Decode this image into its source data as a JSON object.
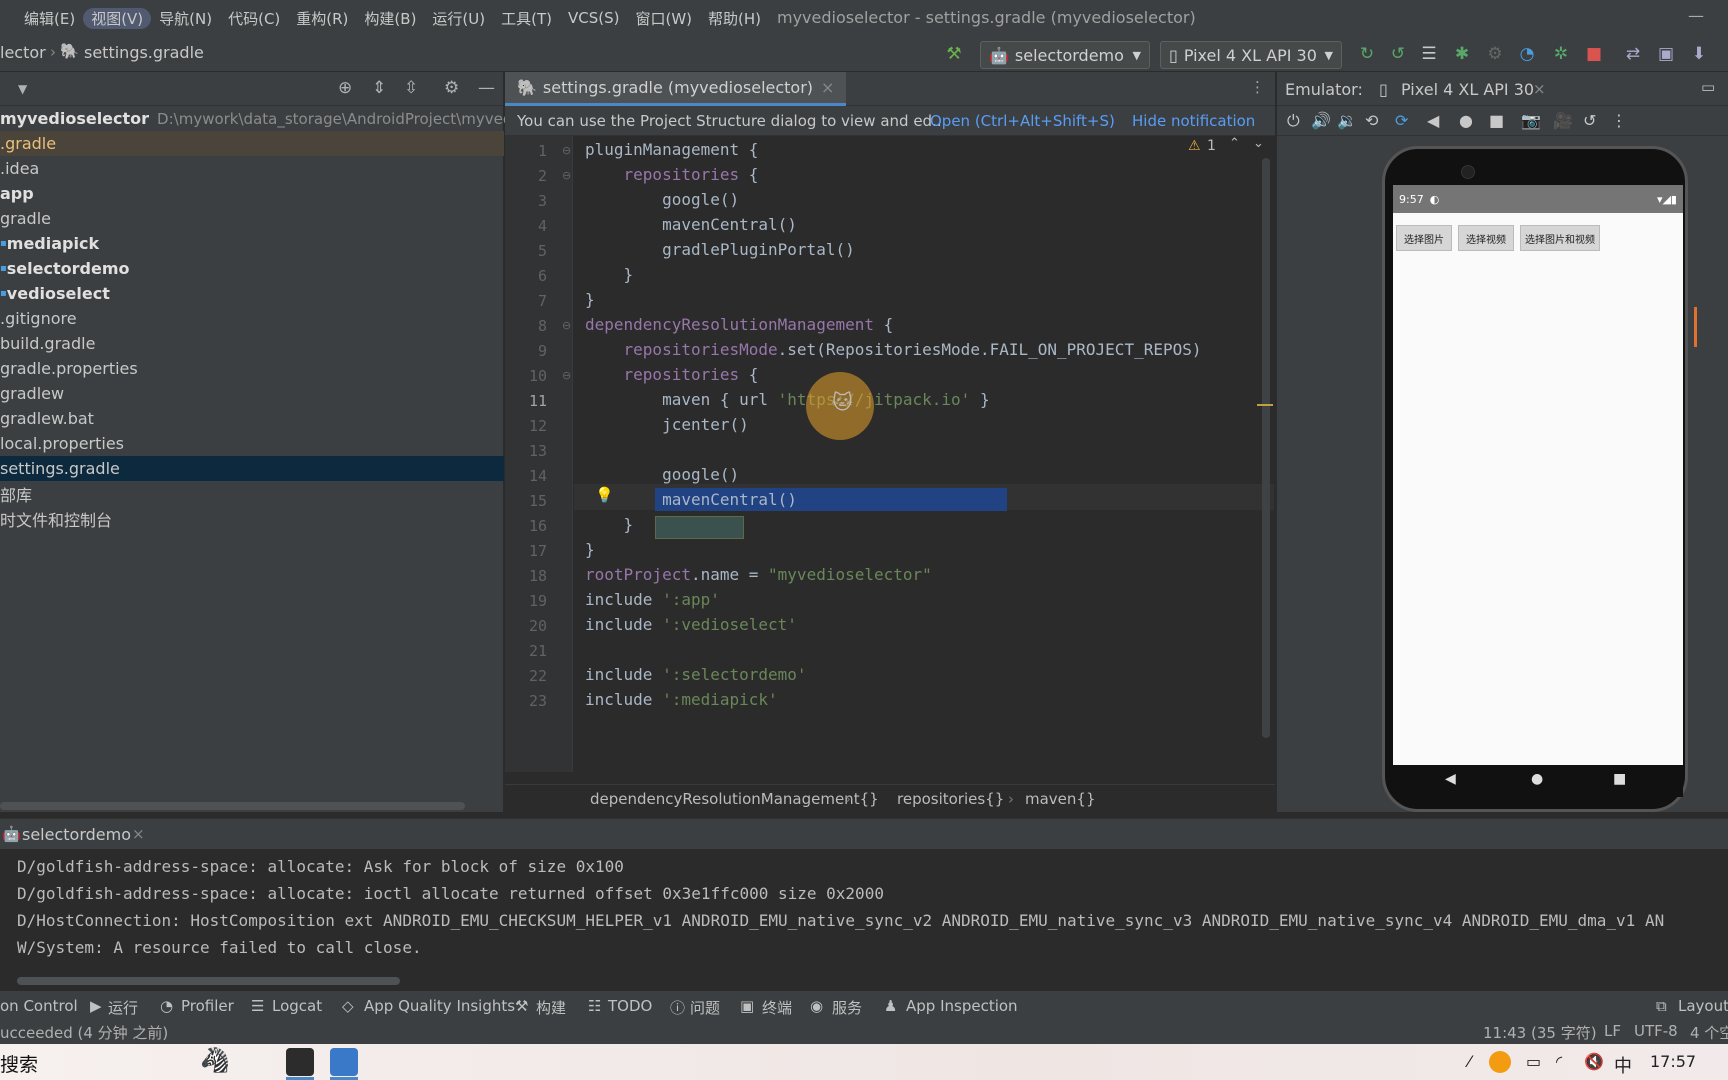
{
  "menubar": {
    "items": [
      "编辑(E)",
      "视图(V)",
      "导航(N)",
      "代码(C)",
      "重构(R)",
      "构建(B)",
      "运行(U)",
      "工具(T)",
      "VCS(S)",
      "窗口(W)",
      "帮助(H)"
    ],
    "window_title": "myvedioselector - settings.gradle (myvedioselector)"
  },
  "navbar": {
    "crumb_project": "lector",
    "crumb_file": "settings.gradle",
    "run_config": "selectordemo",
    "device": "Pixel 4 XL API 30"
  },
  "project": {
    "root_name": "myvedioselector",
    "root_path": "D:\\mywork\\data_storage\\AndroidProject\\myvediosel",
    "items": [
      {
        "label": ".gradle"
      },
      {
        "label": ".idea"
      },
      {
        "label": "app"
      },
      {
        "label": "gradle"
      },
      {
        "label": "mediapick"
      },
      {
        "label": "selectordemo"
      },
      {
        "label": "vedioselect"
      },
      {
        "label": ".gitignore"
      },
      {
        "label": "build.gradle"
      },
      {
        "label": "gradle.properties"
      },
      {
        "label": "gradlew"
      },
      {
        "label": "gradlew.bat"
      },
      {
        "label": "local.properties"
      },
      {
        "label": "settings.gradle"
      },
      {
        "label": "部库"
      },
      {
        "label": "时文件和控制台"
      }
    ]
  },
  "editor": {
    "tab_label": "settings.gradle (myvedioselector)",
    "notification_text": "You can use the Project Structure dialog to view and ed..",
    "notification_link": "Open (Ctrl+Alt+Shift+S)",
    "notification_hide": "Hide notification",
    "warning_count": "1",
    "line_numbers": [
      "1",
      "2",
      "3",
      "4",
      "5",
      "6",
      "7",
      "8",
      "9",
      "10",
      "11",
      "12",
      "13",
      "14",
      "15",
      "16",
      "17",
      "18",
      "19",
      "20",
      "21",
      "22",
      "23"
    ],
    "code": {
      "l1": "pluginManagement {",
      "l2a": "    repositories",
      "l2b": " {",
      "l3": "        google()",
      "l4": "        mavenCentral()",
      "l5": "        gradlePluginPortal()",
      "l6": "    }",
      "l7": "}",
      "l8a": "dependencyResolutionManagement",
      "l8b": " {",
      "l9a": "    repositoriesMode",
      "l9b": ".set(RepositoriesMode.FAIL_ON_PROJECT_REPOS)",
      "l10a": "    repositories",
      "l10b": " {",
      "l11a": "        maven { url ",
      "l11b": "'https://jitpack.io'",
      "l11c": " }",
      "l12": "        jcenter()",
      "l14": "        google()",
      "l15": "        mavenCentral()",
      "l16": "    }",
      "l17": "}",
      "l18a": "rootProject",
      "l18b": ".name = ",
      "l18c": "\"myvedioselector\"",
      "l19a": "include ",
      "l19b": "':app'",
      "l20a": "include ",
      "l20b": "':vedioselect'",
      "l22a": "include ",
      "l22b": "':selectordemo'",
      "l23a": "include ",
      "l23b": "':mediapick'"
    },
    "breadcrumbs": [
      "dependencyResolutionManagement{}",
      "repositories{}",
      "maven{}"
    ]
  },
  "emulator": {
    "label": "Emulator:",
    "device_tab": "Pixel 4 XL API 30",
    "phone_time": "9:57",
    "phone_buttons": [
      "选择图片",
      "选择视频",
      "选择图片和视频"
    ]
  },
  "run": {
    "tab_label": "selectordemo",
    "logs": [
      "D/goldfish-address-space: allocate: Ask for block of size 0x100",
      "D/goldfish-address-space: allocate: ioctl allocate returned offset 0x3e1ffc000 size 0x2000",
      "D/HostConnection: HostComposition ext ANDROID_EMU_CHECKSUM_HELPER_v1 ANDROID_EMU_native_sync_v2 ANDROID_EMU_native_sync_v3 ANDROID_EMU_native_sync_v4 ANDROID_EMU_dma_v1 AN",
      "W/System: A resource failed to call close."
    ]
  },
  "bottom_tools": {
    "version_control": "on Control",
    "run": "运行",
    "profiler": "Profiler",
    "logcat": "Logcat",
    "aqi": "App Quality Insights",
    "build": "构建",
    "todo": "TODO",
    "problems": "问题",
    "terminal": "终端",
    "services": "服务",
    "inspection": "App Inspection",
    "layout": "Layout I"
  },
  "statusbar": {
    "message": "ucceeded (4 分钟 之前)",
    "position": "11:43 (35 字符)",
    "line_sep": "LF",
    "encoding": "UTF-8",
    "indent": "4 个空"
  },
  "taskbar": {
    "search": "搜索",
    "ime": "中",
    "time": "17:57"
  },
  "colors": {
    "accent": "#4a88c7",
    "selection": "#214283",
    "string": "#6a8759",
    "function": "#ffc66d",
    "property": "#9876aa"
  }
}
